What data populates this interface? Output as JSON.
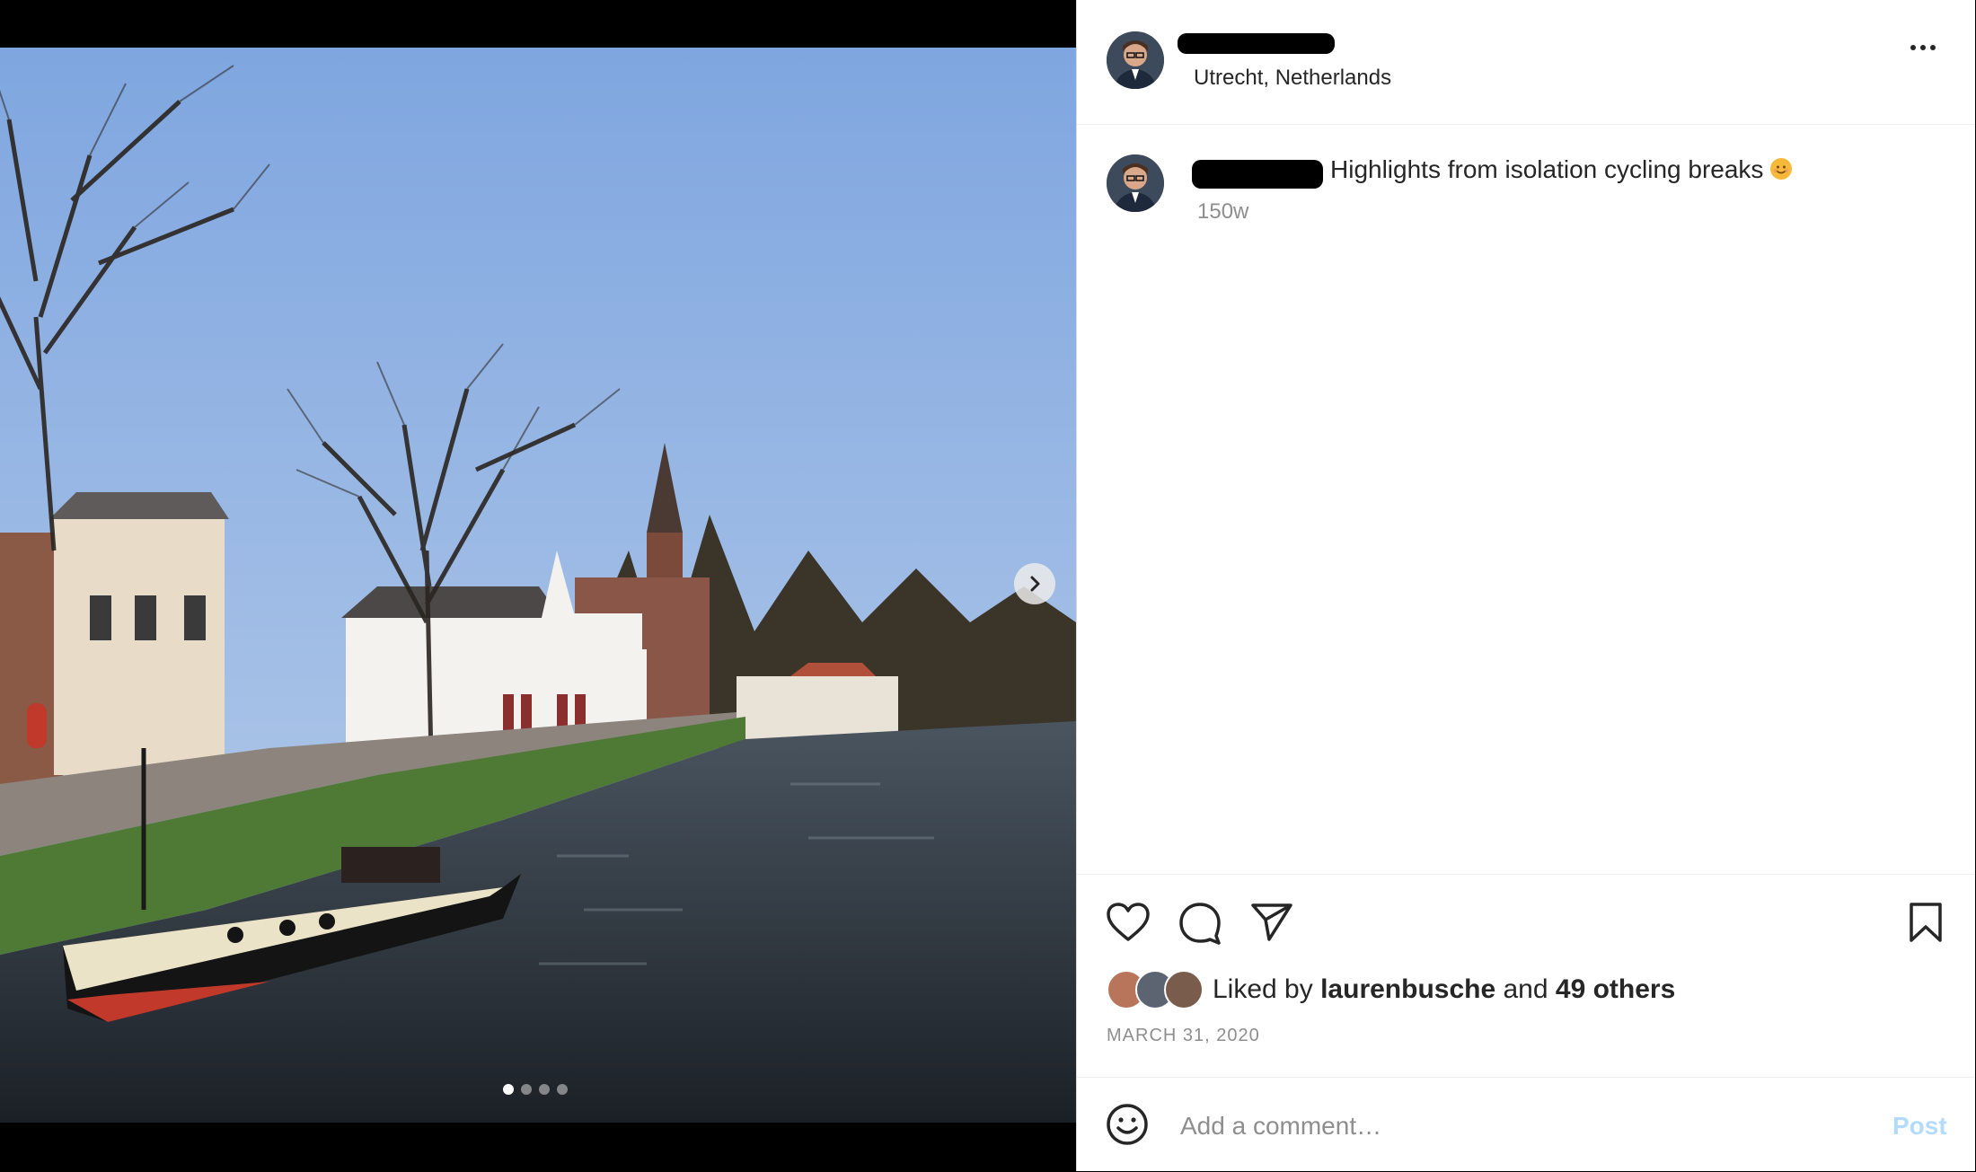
{
  "post": {
    "location": "Utrecht, Netherlands",
    "caption": "Highlights from isolation cycling breaks",
    "caption_age": "150w",
    "liked_by_prefix": "Liked by",
    "liked_by_user": "laurenbusche",
    "liked_by_and": "and",
    "liked_by_others": "49 others",
    "date": "MARCH 31, 2020",
    "carousel": {
      "count": 4,
      "active": 1
    }
  },
  "comment": {
    "placeholder": "Add a comment…",
    "post_label": "Post"
  },
  "icons": {
    "more": "more-options-icon",
    "like": "heart-icon",
    "comment": "comment-icon",
    "share": "paper-plane-icon",
    "save": "bookmark-icon",
    "emoji": "smiley-icon",
    "next": "chevron-right-icon"
  },
  "colors": {
    "text": "#262626",
    "muted": "#8e8e8e",
    "post_disabled": "#b3dbff",
    "divider": "#efefef"
  }
}
